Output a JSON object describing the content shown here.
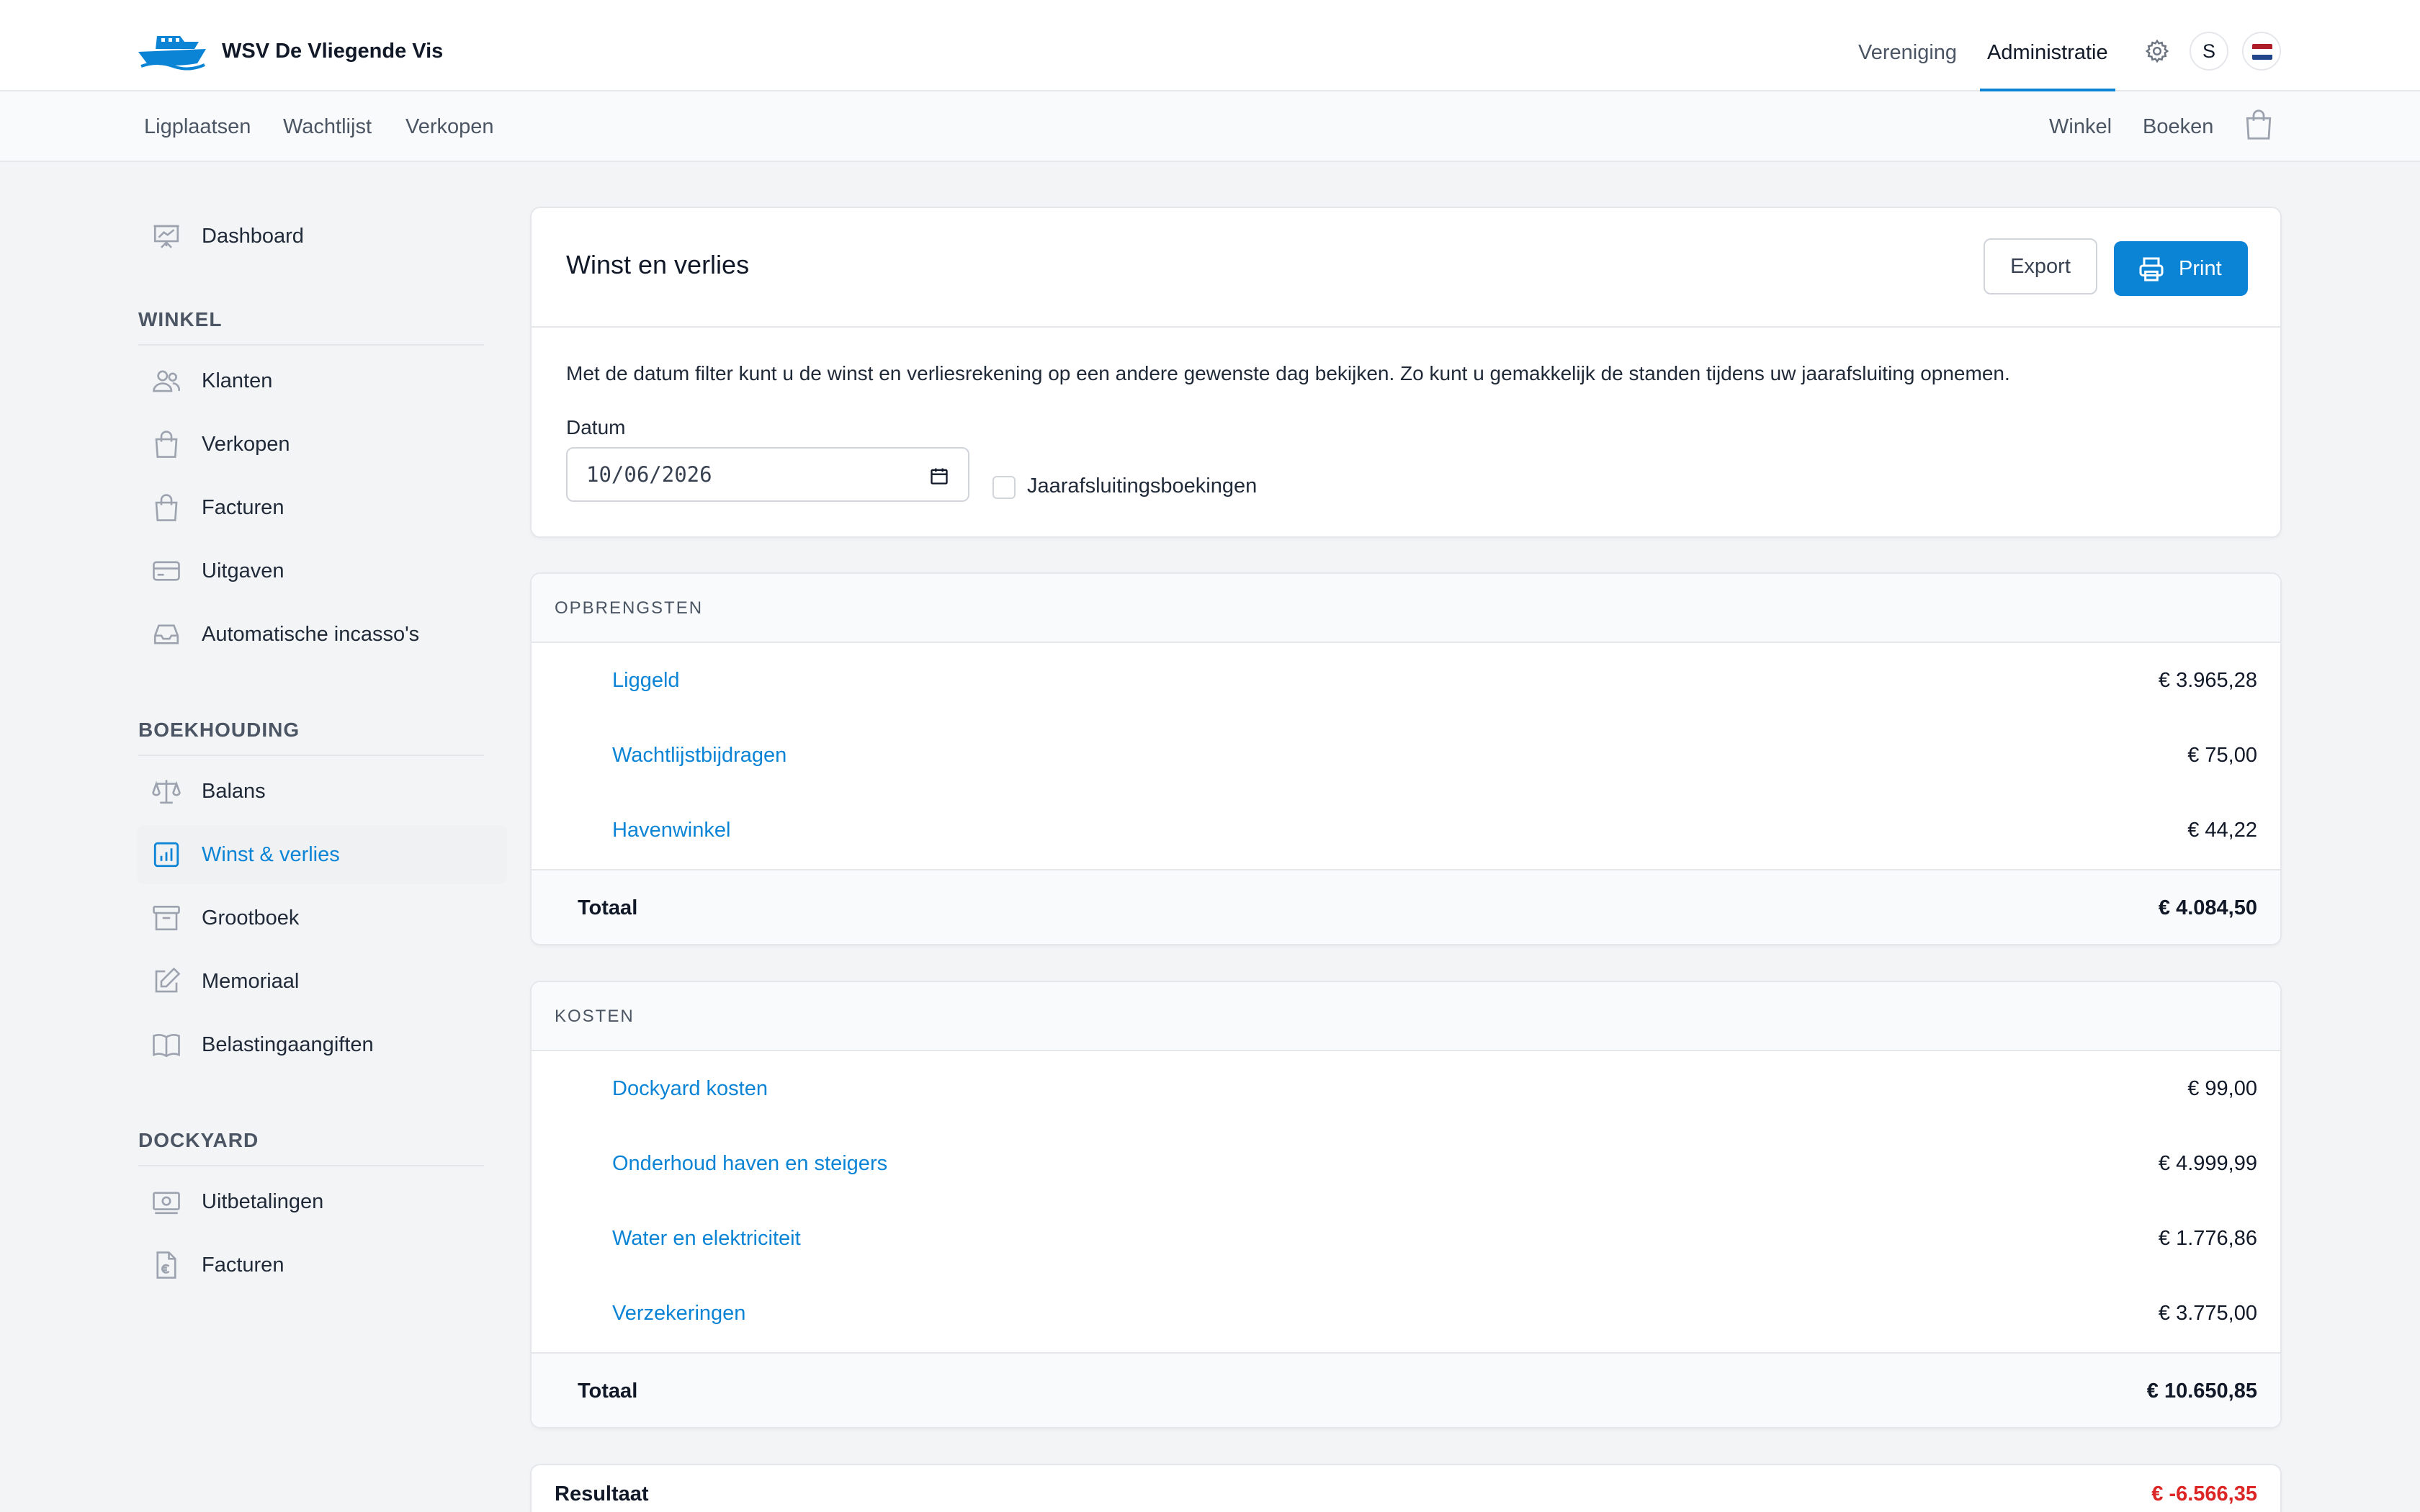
{
  "header": {
    "org_name": "WSV De Vliegende Vis",
    "nav": [
      "Vereniging",
      "Administratie"
    ],
    "active_nav": "Administratie",
    "avatar_initial": "S",
    "accent": "#0b84d6"
  },
  "subnav": {
    "left": [
      "Ligplaatsen",
      "Wachtlijst",
      "Verkopen"
    ],
    "right": [
      "Winkel",
      "Boeken"
    ]
  },
  "sidebar": {
    "dashboard": "Dashboard",
    "winkel_heading": "WINKEL",
    "winkel_items": [
      "Klanten",
      "Verkopen",
      "Facturen",
      "Uitgaven",
      "Automatische incasso's"
    ],
    "boekhouding_heading": "BOEKHOUDING",
    "boekhouding_items": [
      "Balans",
      "Winst & verlies",
      "Grootboek",
      "Memoriaal",
      "Belastingaangiften"
    ],
    "active_item": "Winst & verlies",
    "dockyard_heading": "DOCKYARD",
    "dockyard_items": [
      "Uitbetalingen",
      "Facturen"
    ]
  },
  "report": {
    "title": "Winst en verlies",
    "export_label": "Export",
    "print_label": "Print",
    "intro": "Met de datum filter kunt u de winst en verliesrekening op een andere gewenste dag bekijken. Zo kunt u gemakkelijk de standen tijdens uw jaarafsluiting opnemen.",
    "date_label": "Datum",
    "date_value": "10/06/2026",
    "checkbox_label": "Jaarafsluitingsboekingen",
    "checkbox_checked": false
  },
  "opbrengsten": {
    "heading": "OPBRENGSTEN",
    "rows": [
      {
        "name": "Liggeld",
        "amount": "€ 3.965,28"
      },
      {
        "name": "Wachtlijstbijdragen",
        "amount": "€ 75,00"
      },
      {
        "name": "Havenwinkel",
        "amount": "€ 44,22"
      }
    ],
    "total_label": "Totaal",
    "total": "€ 4.084,50"
  },
  "kosten": {
    "heading": "KOSTEN",
    "rows": [
      {
        "name": "Dockyard kosten",
        "amount": "€ 99,00"
      },
      {
        "name": "Onderhoud haven en steigers",
        "amount": "€ 4.999,99"
      },
      {
        "name": "Water en elektriciteit",
        "amount": "€ 1.776,86"
      },
      {
        "name": "Verzekeringen",
        "amount": "€ 3.775,00"
      }
    ],
    "total_label": "Totaal",
    "total": "€ 10.650,85"
  },
  "resultaat": {
    "label": "Resultaat",
    "amount": "€ -6.566,35",
    "color": "#dc2626"
  }
}
